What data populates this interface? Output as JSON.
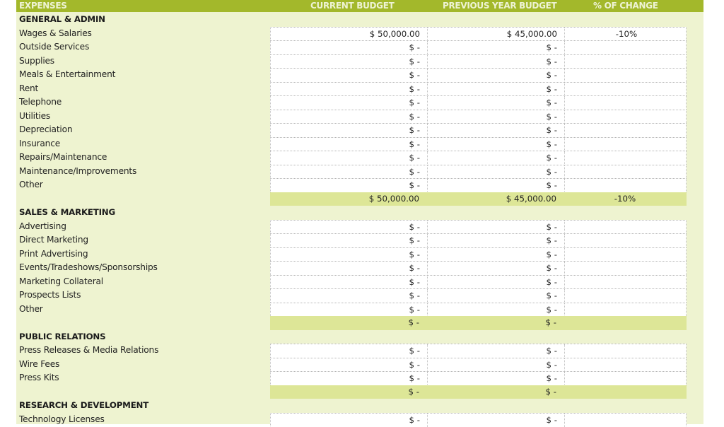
{
  "header": {
    "expenses": "EXPENSES",
    "current_budget": "CURRENT BUDGET",
    "previous_year_budget": "PREVIOUS YEAR BUDGET",
    "pct_change": "% OF CHANGE"
  },
  "sections": [
    {
      "title": "GENERAL & ADMIN",
      "items": [
        {
          "label": "Wages & Salaries",
          "current": "$ 50,000.00",
          "previous": "$ 45,000.00",
          "change": "-10%"
        },
        {
          "label": "Outside Services",
          "current": "$ -",
          "previous": "$ -",
          "change": ""
        },
        {
          "label": "Supplies",
          "current": "$ -",
          "previous": "$ -",
          "change": ""
        },
        {
          "label": "Meals & Entertainment",
          "current": "$ -",
          "previous": "$ -",
          "change": ""
        },
        {
          "label": "Rent",
          "current": "$ -",
          "previous": "$ -",
          "change": ""
        },
        {
          "label": "Telephone",
          "current": "$ -",
          "previous": "$ -",
          "change": ""
        },
        {
          "label": "Utilities",
          "current": "$ -",
          "previous": "$ -",
          "change": ""
        },
        {
          "label": "Depreciation",
          "current": "$ -",
          "previous": "$ -",
          "change": ""
        },
        {
          "label": "Insurance",
          "current": "$ -",
          "previous": "$ -",
          "change": ""
        },
        {
          "label": "Repairs/Maintenance",
          "current": "$ -",
          "previous": "$ -",
          "change": ""
        },
        {
          "label": "Maintenance/Improvements",
          "current": "$ -",
          "previous": "$ -",
          "change": ""
        },
        {
          "label": "Other",
          "current": "$ -",
          "previous": "$ -",
          "change": ""
        }
      ],
      "subtotal": {
        "current": "$ 50,000.00",
        "previous": "$ 45,000.00",
        "change": "-10%"
      }
    },
    {
      "title": "SALES & MARKETING",
      "items": [
        {
          "label": "Advertising",
          "current": "$ -",
          "previous": "$ -",
          "change": ""
        },
        {
          "label": "Direct Marketing",
          "current": "$ -",
          "previous": "$ -",
          "change": ""
        },
        {
          "label": "Print Advertising",
          "current": "$ -",
          "previous": "$ -",
          "change": ""
        },
        {
          "label": "Events/Tradeshows/Sponsorships",
          "current": "$ -",
          "previous": "$ -",
          "change": ""
        },
        {
          "label": "Marketing Collateral",
          "current": "$ -",
          "previous": "$ -",
          "change": ""
        },
        {
          "label": "Prospects Lists",
          "current": "$ -",
          "previous": "$ -",
          "change": ""
        },
        {
          "label": "Other",
          "current": "$ -",
          "previous": "$ -",
          "change": ""
        }
      ],
      "subtotal": {
        "current": "$ -",
        "previous": "$ -",
        "change": ""
      }
    },
    {
      "title": "PUBLIC RELATIONS",
      "items": [
        {
          "label": "Press Releases & Media Relations",
          "current": "$ -",
          "previous": "$ -",
          "change": ""
        },
        {
          "label": "Wire Fees",
          "current": "$ -",
          "previous": "$ -",
          "change": ""
        },
        {
          "label": "Press Kits",
          "current": "$ -",
          "previous": "$ -",
          "change": ""
        }
      ],
      "subtotal": {
        "current": "$ -",
        "previous": "$ -",
        "change": ""
      }
    },
    {
      "title": "RESEARCH & DEVELOPMENT",
      "items": [
        {
          "label": "Technology Licenses",
          "current": "$ -",
          "previous": "$ -",
          "change": ""
        }
      ],
      "subtotal": null
    }
  ],
  "colors": {
    "header_bar": "#a3b82b",
    "sheet_background": "#eef3d0",
    "subtotal_row": "#dde697"
  }
}
